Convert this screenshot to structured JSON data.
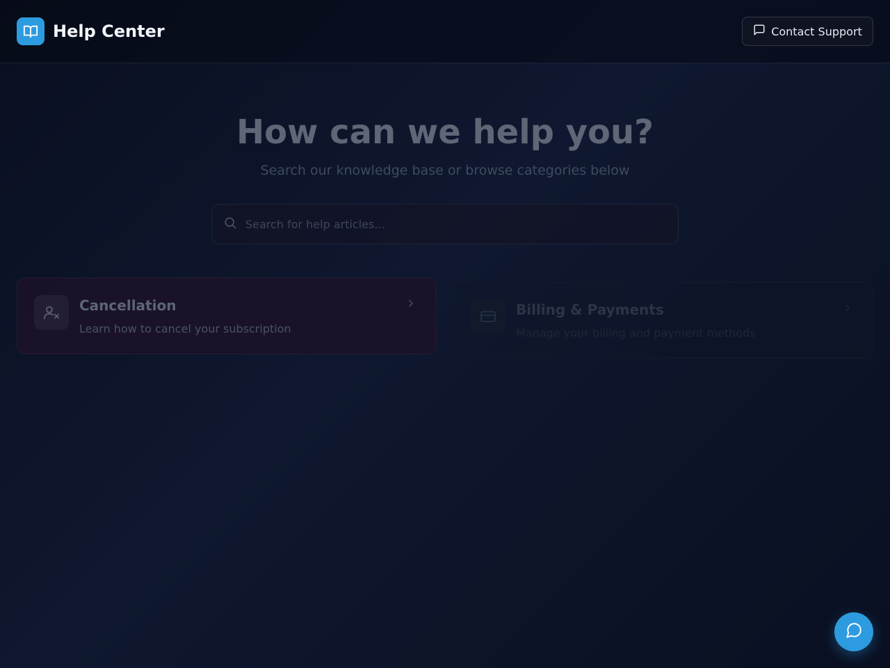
{
  "header": {
    "title": "Help Center",
    "contact_label": "Contact Support"
  },
  "hero": {
    "title": "How can we help you?",
    "subtitle": "Search our knowledge base or browse categories below"
  },
  "search": {
    "placeholder": "Search for help articles..."
  },
  "categories": [
    {
      "title": "Cancellation",
      "description": "Learn how to cancel your subscription",
      "icon": "user-x-icon"
    },
    {
      "title": "Billing & Payments",
      "description": "Manage your billing and payment methods",
      "icon": "credit-card-icon"
    }
  ],
  "colors": {
    "accent": "#2d9be0",
    "background": "#0f1830"
  }
}
